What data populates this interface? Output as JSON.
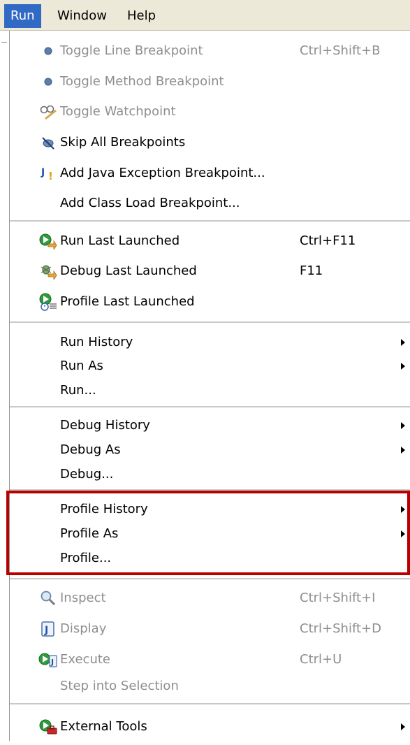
{
  "menubar": {
    "items": [
      {
        "label": "Run",
        "active": true
      },
      {
        "label": "Window",
        "active": false
      },
      {
        "label": "Help",
        "active": false
      }
    ]
  },
  "menu": {
    "items": [
      {
        "label": "Toggle Line Breakpoint",
        "shortcut": "Ctrl+Shift+B",
        "icon": "breakpoint-dot-icon",
        "disabled": true
      },
      {
        "label": "Toggle Method Breakpoint",
        "icon": "breakpoint-dot-icon",
        "disabled": true
      },
      {
        "label": "Toggle Watchpoint",
        "icon": "watchpoint-glasses-icon",
        "disabled": true
      },
      {
        "label": "Skip All Breakpoints",
        "icon": "skip-breakpoints-icon"
      },
      {
        "label": "Add Java Exception Breakpoint...",
        "icon": "java-exception-icon"
      },
      {
        "label": "Add Class Load Breakpoint..."
      },
      {
        "label": "Run Last Launched",
        "shortcut": "Ctrl+F11",
        "icon": "run-launch-icon"
      },
      {
        "label": "Debug Last Launched",
        "shortcut": "F11",
        "icon": "debug-bug-icon"
      },
      {
        "label": "Profile Last Launched",
        "icon": "profile-launch-icon"
      },
      {
        "label": "Run History",
        "submenu": true
      },
      {
        "label": "Run As",
        "submenu": true
      },
      {
        "label": "Run..."
      },
      {
        "label": "Debug History",
        "submenu": true
      },
      {
        "label": "Debug As",
        "submenu": true
      },
      {
        "label": "Debug..."
      },
      {
        "label": "Profile History",
        "submenu": true
      },
      {
        "label": "Profile As",
        "submenu": true
      },
      {
        "label": "Profile..."
      },
      {
        "label": "Inspect",
        "shortcut": "Ctrl+Shift+I",
        "icon": "magnifier-icon",
        "disabled": true
      },
      {
        "label": "Display",
        "shortcut": "Ctrl+Shift+D",
        "icon": "display-j-icon",
        "disabled": true
      },
      {
        "label": "Execute",
        "shortcut": "Ctrl+U",
        "icon": "execute-run-j-icon",
        "disabled": true
      },
      {
        "label": "Step into Selection",
        "disabled": true
      },
      {
        "label": "External Tools",
        "icon": "external-tools-icon",
        "submenu": true
      }
    ]
  },
  "colors": {
    "menubar_bg": "#ece9d8",
    "active_bg": "#316ac5",
    "highlight_border": "#b80000",
    "disabled_text": "#8e8e8e",
    "separator": "#c9c9c9"
  }
}
